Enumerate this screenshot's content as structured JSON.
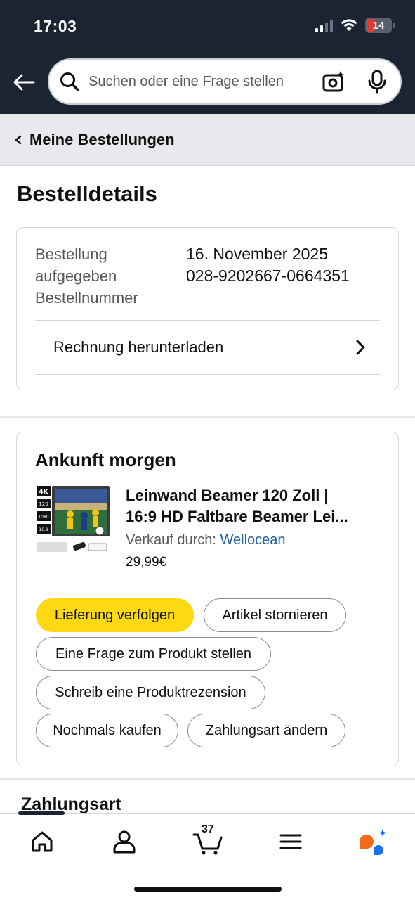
{
  "status_bar": {
    "time": "17:03",
    "battery": "14"
  },
  "search": {
    "placeholder": "Suchen oder eine Frage stellen"
  },
  "breadcrumb": {
    "label": "Meine Bestellungen"
  },
  "page": {
    "title": "Bestelldetails"
  },
  "order_info": {
    "label_placed": "Bestellung aufgegeben",
    "label_number": "Bestellnummer",
    "date": "16. November 2025",
    "number": "028-9202667-0664351",
    "invoice_link": "Rechnung herunterladen"
  },
  "shipment": {
    "heading": "Ankunft morgen",
    "product": {
      "title_line1": "Leinwand Beamer 120 Zoll |",
      "title_line2": "16:9 HD Faltbare Beamer Lei...",
      "sold_by_label": "Verkauf durch:",
      "seller": "Wellocean",
      "price": "29,99€",
      "image_badges": [
        "4K",
        "120",
        "1080",
        "16:9"
      ]
    },
    "buttons": {
      "track": "Lieferung verfolgen",
      "cancel": "Artikel stornieren",
      "question": "Eine Frage zum Produkt stellen",
      "review": "Schreib eine Produktrezension",
      "buy_again": "Nochmals kaufen",
      "change_payment": "Zahlungsart ändern"
    }
  },
  "payment": {
    "heading": "Zahlungsart"
  },
  "bottom_nav": {
    "cart_count": "37"
  },
  "colors": {
    "header_bg": "#1b2433",
    "primary_button": "#ffd814",
    "link": "#2162a1",
    "battery_low": "#e23b36"
  }
}
